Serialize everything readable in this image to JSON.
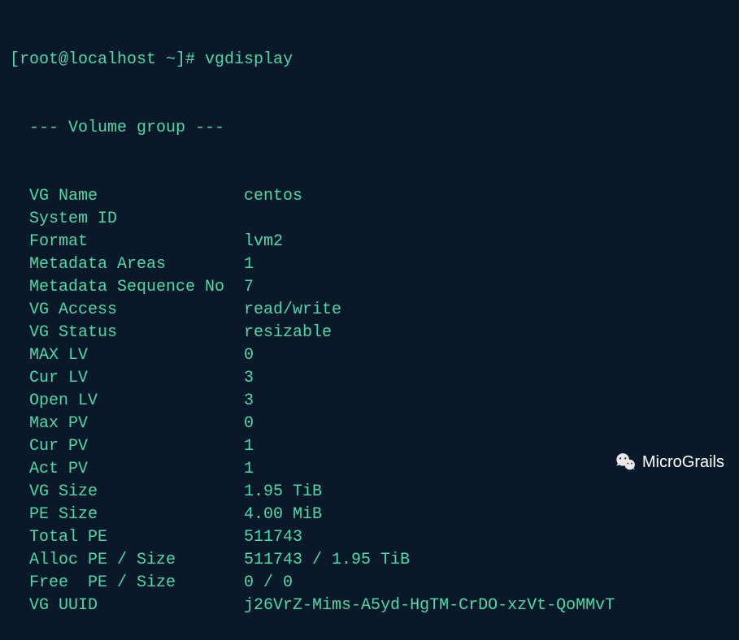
{
  "prompt": "[root@localhost ~]# ",
  "command": "vgdisplay",
  "header": "--- Volume group ---",
  "fields": [
    {
      "label": "VG Name",
      "value": "centos"
    },
    {
      "label": "System ID",
      "value": ""
    },
    {
      "label": "Format",
      "value": "lvm2"
    },
    {
      "label": "Metadata Areas",
      "value": "1"
    },
    {
      "label": "Metadata Sequence No",
      "value": "7"
    },
    {
      "label": "VG Access",
      "value": "read/write"
    },
    {
      "label": "VG Status",
      "value": "resizable"
    },
    {
      "label": "MAX LV",
      "value": "0"
    },
    {
      "label": "Cur LV",
      "value": "3"
    },
    {
      "label": "Open LV",
      "value": "3"
    },
    {
      "label": "Max PV",
      "value": "0"
    },
    {
      "label": "Cur PV",
      "value": "1"
    },
    {
      "label": "Act PV",
      "value": "1"
    },
    {
      "label": "VG Size",
      "value": "1.95 TiB"
    },
    {
      "label": "PE Size",
      "value": "4.00 MiB"
    },
    {
      "label": "Total PE",
      "value": "511743"
    },
    {
      "label": "Alloc PE / Size",
      "value": "511743 / 1.95 TiB"
    },
    {
      "label": "Free  PE / Size",
      "value": "0 / 0"
    },
    {
      "label": "VG UUID",
      "value": "j26VrZ-Mims-A5yd-HgTM-CrDO-xzVt-QoMMvT"
    }
  ],
  "watermark": "MicroGrails"
}
